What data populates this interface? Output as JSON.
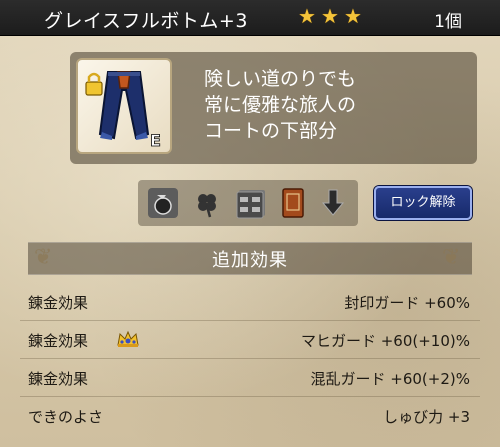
{
  "header": {
    "item_name": "グレイスフルボトム+3",
    "star_count": 3,
    "star_color": "#f4c43a",
    "quantity": "1個"
  },
  "item": {
    "icon": "blue-coat-bottom-icon",
    "lock_icon": "padlock-icon",
    "equipped_badge": "E",
    "description_lines": [
      "険しい道のりでも",
      "常に優雅な旅人の",
      "コートの下部分"
    ]
  },
  "category_icons": [
    "bag-icon",
    "clover-icon",
    "storage-drawer-icon",
    "book-icon",
    "arrow-down-icon"
  ],
  "lock_button": {
    "label": "ロック解除",
    "color": "#1e3380"
  },
  "section": {
    "title": "追加効果"
  },
  "effects": [
    {
      "label": "錬金効果",
      "value": "封印ガード +60%",
      "has_crown": false
    },
    {
      "label": "錬金効果",
      "value": "マヒガード +60(+10)%",
      "has_crown": true
    },
    {
      "label": "錬金効果",
      "value": "混乱ガード +60(+2)%",
      "has_crown": false
    },
    {
      "label": "できのよさ",
      "value": "しゅび力 +3",
      "has_crown": false
    }
  ]
}
